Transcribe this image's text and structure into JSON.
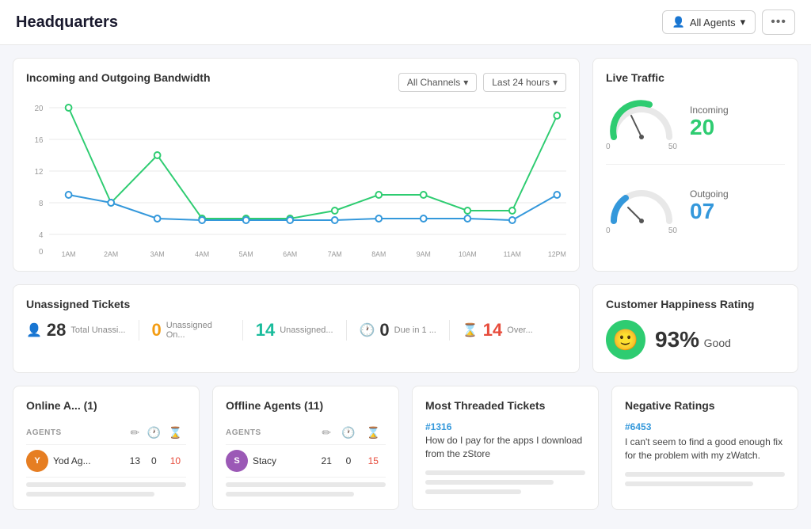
{
  "header": {
    "title": "Headquarters",
    "agents_btn": "All Agents",
    "more_icon": "•••"
  },
  "bandwidth": {
    "title": "Incoming and Outgoing Bandwidth",
    "filter_channel": "All Channels",
    "filter_time": "Last 24 hours",
    "y_labels": [
      "0",
      "4",
      "8",
      "12",
      "16",
      "20"
    ],
    "x_labels": [
      "1AM",
      "2AM",
      "3AM",
      "4AM",
      "5AM",
      "6AM",
      "7AM",
      "8AM",
      "9AM",
      "10AM",
      "11AM",
      "12PM"
    ]
  },
  "live_traffic": {
    "title": "Live Traffic",
    "incoming_label": "Incoming",
    "incoming_value": "20",
    "incoming_min": "0",
    "incoming_max": "50",
    "outgoing_label": "Outgoing",
    "outgoing_value": "07",
    "outgoing_min": "0",
    "outgoing_max": "50"
  },
  "unassigned": {
    "title": "Unassigned Tickets",
    "total_num": "28",
    "total_label": "Total Unassi...",
    "online_num": "0",
    "online_label": "Unassigned On...",
    "unassigned_num": "14",
    "unassigned_label": "Unassigned...",
    "due_num": "0",
    "due_label": "Due in 1 ...",
    "over_num": "14",
    "over_label": "Over..."
  },
  "happiness": {
    "title": "Customer Happiness Rating",
    "value": "93%",
    "desc": "Good"
  },
  "online_agents": {
    "title": "Online A... (1)",
    "col_agents": "AGENTS",
    "col_tickets": "✏",
    "col_clock": "🕐",
    "col_overdue": "⌛",
    "agents": [
      {
        "name": "Yod Ag...",
        "tickets": "13",
        "clock": "0",
        "overdue": "10",
        "avatar_initials": "Y"
      }
    ]
  },
  "offline_agents": {
    "title": "Offline Agents (11)",
    "col_agents": "AGENTS",
    "col_tickets": "✏",
    "col_clock": "🕐",
    "col_overdue": "⌛",
    "agents": [
      {
        "name": "Stacy",
        "tickets": "21",
        "clock": "0",
        "overdue": "15",
        "avatar_initials": "S"
      }
    ]
  },
  "most_threaded": {
    "title": "Most Threaded Tickets",
    "ticket_id": "#1316",
    "ticket_desc": "How do I pay for the apps I download from the zStore"
  },
  "negative_ratings": {
    "title": "Negative Ratings",
    "ticket_id": "#6453",
    "ticket_desc": "I can't seem to find a good enough fix for the problem with my zWatch."
  }
}
